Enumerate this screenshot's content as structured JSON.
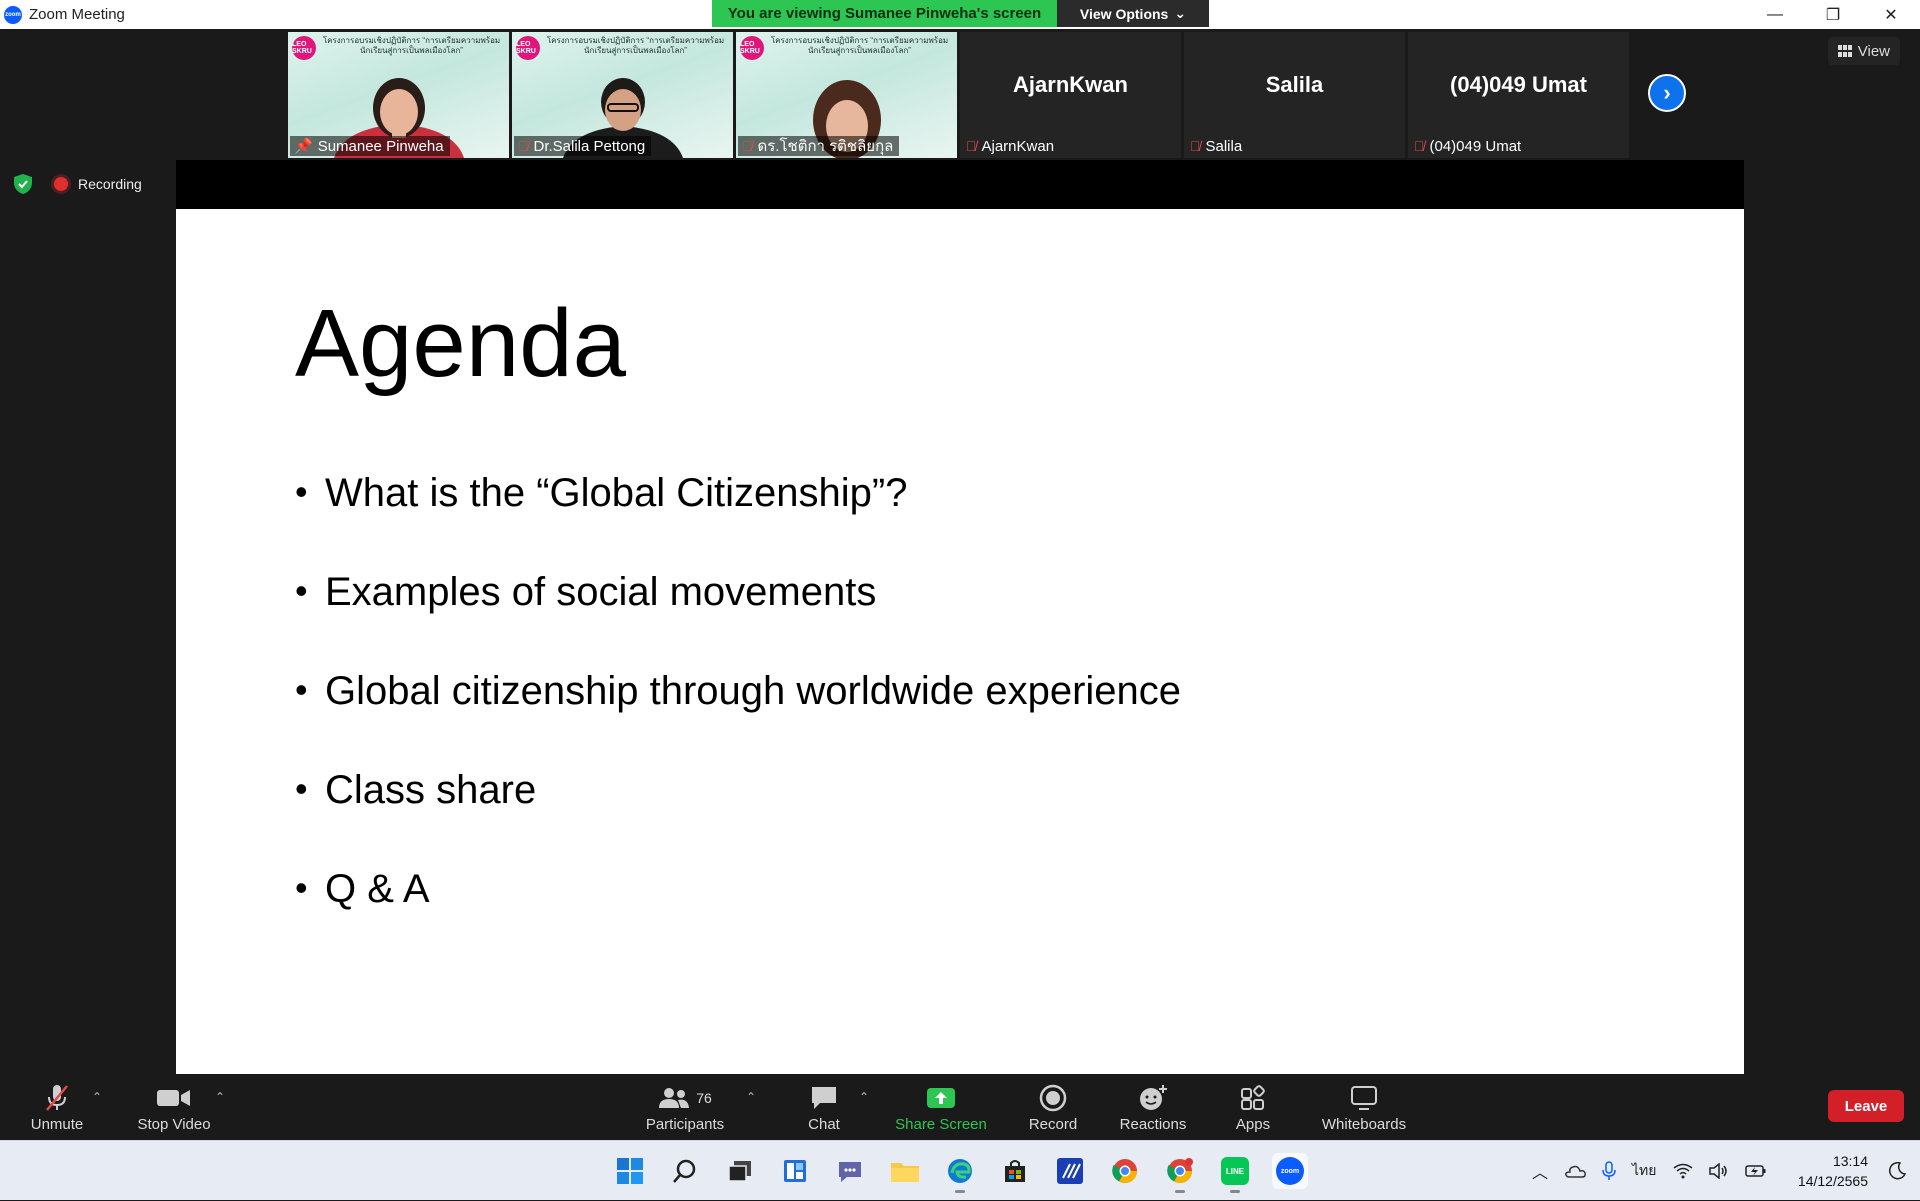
{
  "window": {
    "title": "Zoom Meeting",
    "logo_text": "zoom",
    "minimize": "—",
    "restore": "❐",
    "close": "✕"
  },
  "share_banner": {
    "viewing_text": "You are viewing Sumanee Pinweha's screen",
    "view_options_label": "View Options"
  },
  "gallery": {
    "tiles": [
      {
        "name": "Sumanee Pinweha",
        "type": "video",
        "pinned": true,
        "banner": "โครงการอบรมเชิงปฏิบัติการ “การเตรียมความพร้อมนักเรียนสู่การเป็นพลเมืองโลก”"
      },
      {
        "name": "Dr.Salila Pettong",
        "type": "video",
        "banner": "โครงการอบรมเชิงปฏิบัติการ “การเตรียมความพร้อมนักเรียนสู่การเป็นพลเมืองโลก”"
      },
      {
        "name": "ดร.โชติกา รติชลิยกุล",
        "type": "video",
        "banner": "โครงการอบรมเชิงปฏิบัติการ “การเตรียมความพร้อมนักเรียนสู่การเป็นพลเมืองโลก”"
      },
      {
        "name": "AjarnKwan",
        "display": "AjarnKwan",
        "type": "name"
      },
      {
        "name": "Salila",
        "display": "Salila",
        "type": "name"
      },
      {
        "name": "(04)049 Umat",
        "display": "(04)049 Umat",
        "type": "name"
      }
    ],
    "logo_badge": "LEO SKRU",
    "view_label": "View"
  },
  "status": {
    "recording_label": "Recording"
  },
  "slide": {
    "title": "Agenda",
    "items": [
      "What is the “Global Citizenship”?",
      "Examples of social movements",
      "Global citizenship through worldwide experience",
      "Class share",
      "Q & A"
    ]
  },
  "controls": {
    "unmute": "Unmute",
    "stop_video": "Stop Video",
    "participants": "Participants",
    "participant_count": "76",
    "chat": "Chat",
    "share_screen": "Share Screen",
    "record": "Record",
    "reactions": "Reactions",
    "apps": "Apps",
    "whiteboards": "Whiteboards",
    "leave": "Leave"
  },
  "taskbar": {
    "language": "ไทย",
    "time": "13:14",
    "date": "14/12/2565",
    "line_label": "LINE",
    "zoom_label": "zoom"
  },
  "colors": {
    "share_green": "#2dc653",
    "leave_red": "#d32028",
    "zoom_blue": "#0b5cff",
    "active_tile_border": "#8ed14b"
  }
}
